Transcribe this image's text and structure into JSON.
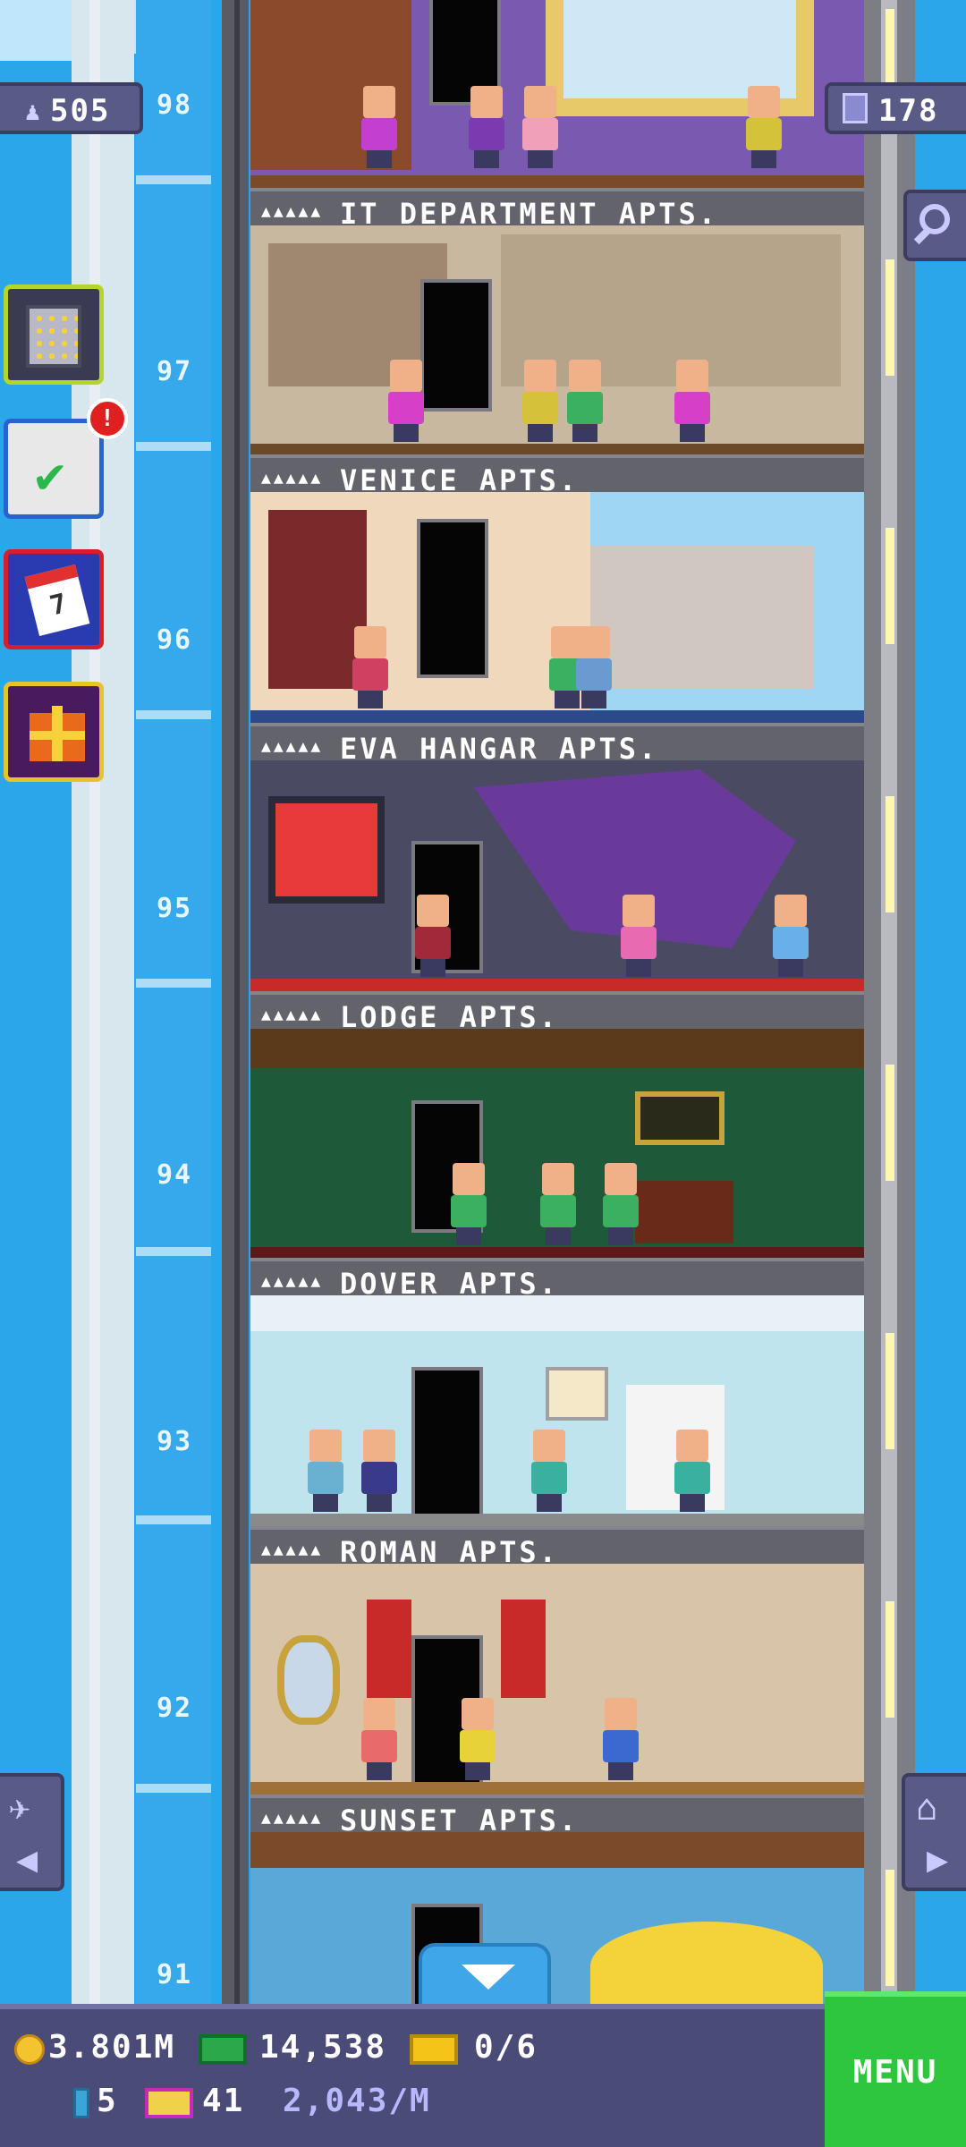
{
  "hud": {
    "population": "505",
    "floor_count": "178"
  },
  "floors": [
    {
      "number": "98",
      "name": ""
    },
    {
      "number": "97",
      "name": "IT DEPARTMENT APTS."
    },
    {
      "number": "96",
      "name": "VENICE APTS."
    },
    {
      "number": "95",
      "name": "EVA HANGAR APTS."
    },
    {
      "number": "94",
      "name": "LODGE APTS."
    },
    {
      "number": "93",
      "name": "DOVER APTS."
    },
    {
      "number": "92",
      "name": "ROMAN APTS."
    },
    {
      "number": "91",
      "name": "SUNSET APTS."
    }
  ],
  "tasks_alert": "!",
  "calendar_day": "7",
  "bottom": {
    "coins": "3.801M",
    "bux": "14,538",
    "tickets": "0/6",
    "elevators": "5",
    "vip": "41",
    "income": "2,043/M",
    "menu_label": "MENU"
  },
  "colors": {
    "sky": "#2aa6ea",
    "hud_panel": "#5a5a86",
    "menu_green": "#2dc63e",
    "label_bar": "#63636b"
  }
}
